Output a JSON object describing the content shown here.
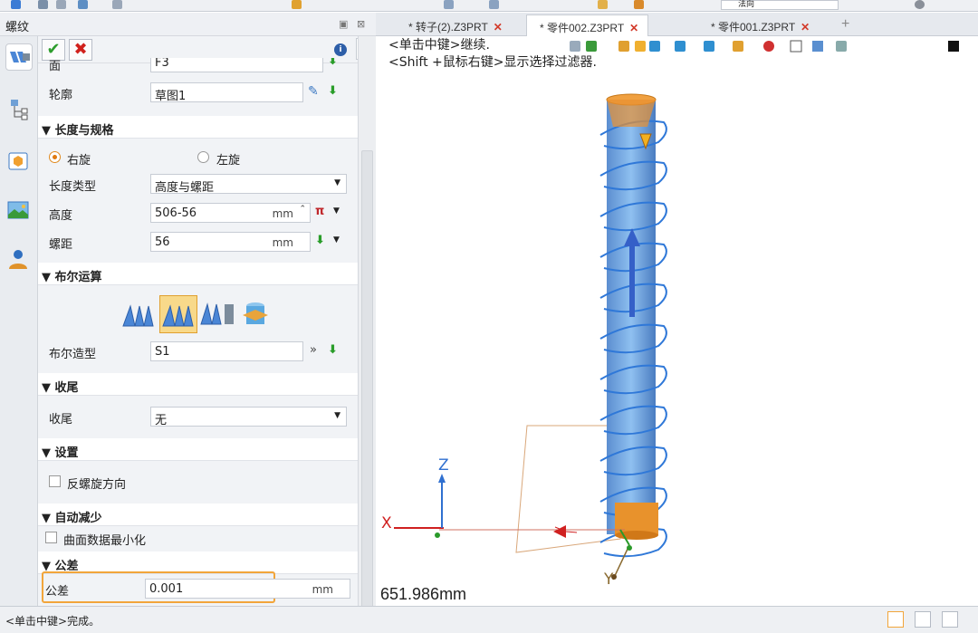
{
  "top_toolbar": {
    "field_label": "法向"
  },
  "panel": {
    "title": "螺纹"
  },
  "tabs": [
    {
      "label": "* 转子(2).Z3PRT"
    },
    {
      "label": "* 零件002.Z3PRT"
    },
    {
      "label": "* 零件001.Z3PRT"
    }
  ],
  "form": {
    "face": {
      "label": "面",
      "value": "F3"
    },
    "profile": {
      "label": "轮廓",
      "value": "草图1"
    },
    "section_length": "▼ 长度与规格",
    "hand_right": "右旋",
    "hand_left": "左旋",
    "length_type": {
      "label": "长度类型",
      "value": "高度与螺距"
    },
    "height": {
      "label": "高度",
      "value": "506-56",
      "unit": "mm"
    },
    "pitch": {
      "label": "螺距",
      "value": "56",
      "unit": "mm"
    },
    "section_boolean": "▼ 布尔运算",
    "boolean_shape": {
      "label": "布尔造型",
      "value": "S1"
    },
    "section_runout": "▼ 收尾",
    "runout": {
      "label": "收尾",
      "value": "无"
    },
    "section_settings": "▼ 设置",
    "reverse": "反螺旋方向",
    "section_reduce": "▼ 自动减少",
    "minimize": "曲面数据最小化",
    "section_tolerance": "▼ 公差",
    "tolerance": {
      "label": "公差",
      "value": "0.001",
      "unit": "mm"
    }
  },
  "viewport": {
    "hint1": "<单击中键>继续.",
    "hint2": "<Shift +鼠标右键>显示选择过滤器.",
    "measure": "651.986mm",
    "axis_x": "X",
    "axis_y": "Y",
    "axis_z": "Z"
  },
  "status": {
    "text": "<单击中键>完成。"
  },
  "colors": {
    "helix": "#5b9ae0",
    "highlight": "#f2a53a"
  }
}
